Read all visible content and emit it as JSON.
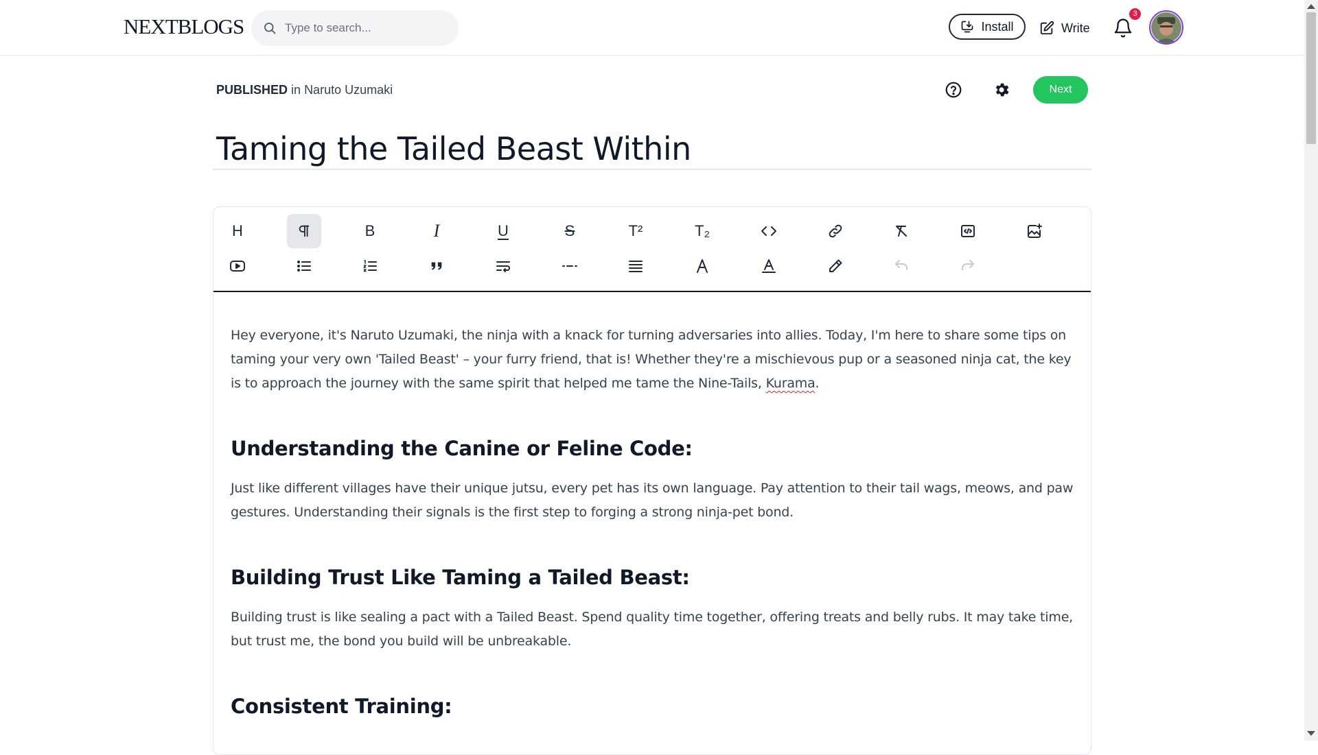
{
  "nav": {
    "logo": "NEXTBLOGS",
    "search_placeholder": "Type to search...",
    "install_label": "Install",
    "write_label": "Write",
    "notification_count": "3"
  },
  "post": {
    "status_label": "PUBLISHED",
    "status_in": "in",
    "publication": "Naruto Uzumaki",
    "next_label": "Next",
    "title": "Taming the Tailed Beast Within"
  },
  "toolbar": {
    "row1": [
      "heading",
      "paragraph",
      "bold",
      "italic",
      "underline",
      "strikethrough",
      "superscript",
      "subscript",
      "code",
      "link",
      "clear-format",
      "code-block",
      "insert-image"
    ],
    "row2": [
      "youtube",
      "bullet-list",
      "ordered-list",
      "blockquote",
      "hard-break",
      "horizontal-rule",
      "align",
      "font-size",
      "text-color",
      "highlight",
      "undo",
      "redo"
    ],
    "active": "paragraph",
    "disabled": [
      "undo",
      "redo"
    ],
    "heading_letter": "H",
    "bold_letter": "B",
    "italic_letter": "I",
    "underline_letter": "U",
    "strike_letter": "S",
    "super_letter": "T²",
    "sub_letter": "T₂"
  },
  "content": {
    "intro_part1": "Hey everyone, it's Naruto Uzumaki, the ninja with a knack for turning adversaries into allies. Today, I'm here to share some tips on taming your very own 'Tailed Beast' – your furry friend, that is! Whether they're a mischievous pup or a seasoned ninja cat, the key is to approach the journey with the same spirit that helped me tame the Nine-Tails,",
    "intro_misspelled": "Kurama",
    "intro_end": ".",
    "h1": "Understanding the Canine or Feline Code:",
    "p1": "Just like different villages have their unique jutsu, every pet has its own language. Pay attention to their tail wags, meows, and paw gestures. Understanding their signals is the first step to forging a strong ninja-pet bond.",
    "h2": "Building Trust Like Taming a Tailed Beast:",
    "p2": "Building trust is like sealing a pact with a Tailed Beast. Spend quality time together, offering treats and belly rubs. It may take time, but trust me, the bond you build will be unbreakable.",
    "h3": "Consistent Training:"
  },
  "colors": {
    "accent_green": "#22c55e",
    "badge_red": "#e11d48",
    "avatar_ring": "#7c3aed"
  }
}
